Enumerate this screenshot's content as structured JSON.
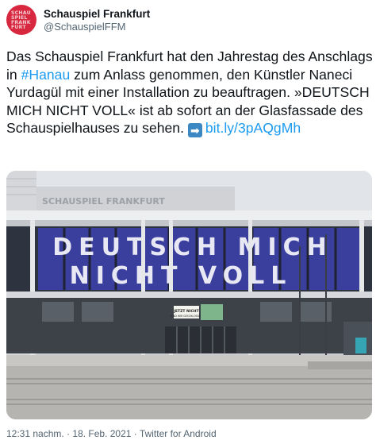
{
  "account": {
    "display_name": "Schauspiel Frankfurt",
    "handle": "@SchauspielFFM",
    "avatar_lines": "SCHAU\nSPIEL\nFRANK\nFURT"
  },
  "tweet": {
    "text_part1": "Das Schauspiel Frankfurt hat den Jahrestag des Anschlags in ",
    "hashtag": "#Hanau",
    "text_part2": " zum Anlass genommen, den Künstler Naneci Yurdagül mit einer Installation zu beauftragen. »DEUTSCH MICH NICHT VOLL« ist ab sofort an der Glasfassade des Schauspielhauses zu sehen. ",
    "link_icon": "arrow-right-emoji",
    "link": "bit.ly/3pAQgMh"
  },
  "photo": {
    "facade_lettering": "SCHAUSPIEL FRANKFURT",
    "installation_line1": "DEUTSCH MICH",
    "installation_line2": "NICHT VOLL",
    "door_sign_line1": "JETZT NICHT",
    "door_sign_line2": "SIND WIR GESCHLOSSEN",
    "colors": {
      "banner": "#3a3f9e",
      "sky": "#dfe3e7",
      "ground": "#b5b3b0"
    }
  },
  "meta": {
    "time": "12:31 nachm.",
    "separator": " · ",
    "date": "18. Feb. 2021",
    "source": "Twitter for Android"
  }
}
